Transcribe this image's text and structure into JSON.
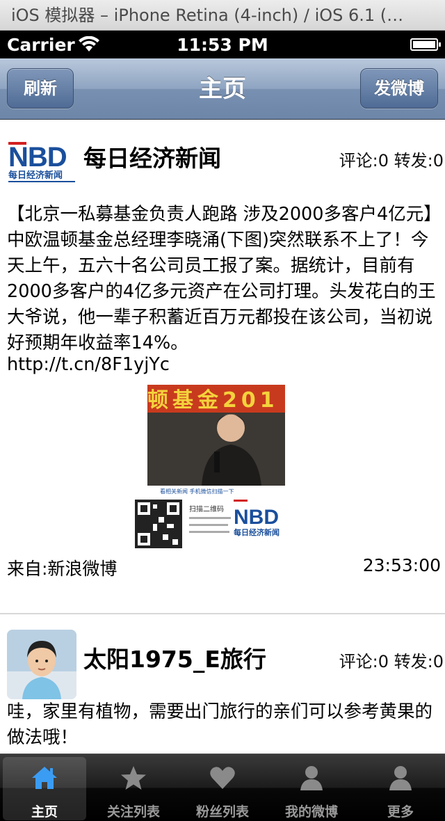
{
  "simulator": {
    "title": "iOS 模拟器 – iPhone Retina (4-inch) / iOS 6.1 (…"
  },
  "status_bar": {
    "carrier": "Carrier",
    "time": "11:53 PM",
    "wifi_icon": "wifi-icon",
    "battery_icon": "battery-icon"
  },
  "nav": {
    "left_button": "刷新",
    "title": "主页",
    "right_button": "发微博"
  },
  "posts": [
    {
      "username": "每日经济新闻",
      "stats": "评论:0 转发:0",
      "avatar_text": "NBD",
      "avatar_subtext": "每日经济新闻",
      "text": "【北京一私募基金负责人跑路 涉及2000多客户4亿元】中欧温顿基金总经理李晓涌(下图)突然联系不上了！今天上午，五六十名公司员工报了案。据统计，目前有2000多客户的4亿多元资产在公司打理。头发花白的王大爷说，他一辈子积蓄近百万元都投在该公司，当初说好预期年收益率14%。",
      "url": "http://t.cn/8F1yjYc",
      "image": {
        "banner_text": "顿基金201",
        "caption": "看相关新闻 手机微信扫描一下",
        "scan_text": "扫描二维码",
        "nbd": "NBD",
        "nbd_sub": "每日经济新闻"
      },
      "source": "来自:新浪微博",
      "time": "23:53:00"
    },
    {
      "username": "太阳1975_E旅行",
      "stats": "评论:0 转发:0",
      "text": "哇，家里有植物，需要出门旅行的亲们可以参考黄果的做法哦！"
    }
  ],
  "tabs": [
    {
      "label": "主页",
      "icon": "home-icon",
      "active": true
    },
    {
      "label": "关注列表",
      "icon": "star-icon",
      "active": false
    },
    {
      "label": "粉丝列表",
      "icon": "heart-icon",
      "active": false
    },
    {
      "label": "我的微博",
      "icon": "person-icon",
      "active": false
    },
    {
      "label": "更多",
      "icon": "person-icon",
      "active": false
    }
  ],
  "colors": {
    "nav_blue": "#7890b1",
    "nbd_blue": "#1a4f9c",
    "nbd_red": "#d22020",
    "tab_active_icon": "#3b9cf3"
  }
}
